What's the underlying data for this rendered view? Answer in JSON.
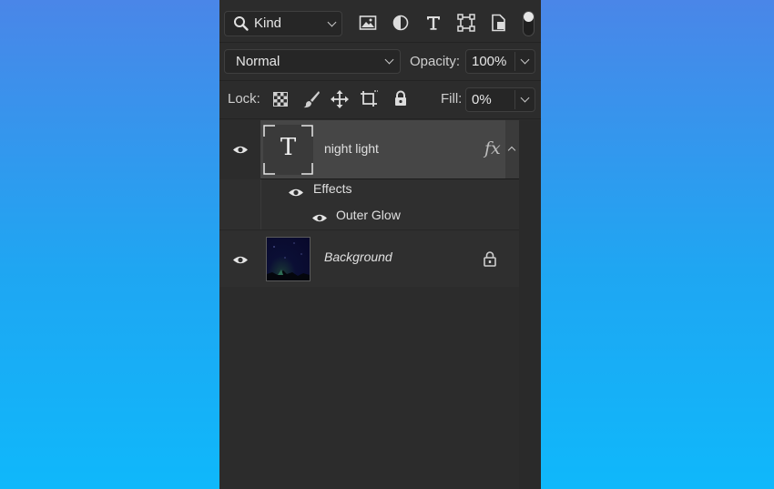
{
  "filter": {
    "kind_label": "Kind",
    "icons": [
      "search-icon",
      "image-filter-icon",
      "adjustment-filter-icon",
      "type-filter-icon",
      "shape-filter-icon",
      "smart-object-filter-icon",
      "filter-toggle"
    ]
  },
  "blend": {
    "mode": "Normal",
    "opacity_label": "Opacity:",
    "opacity_value": "100%"
  },
  "lock": {
    "label": "Lock:",
    "icons": [
      "lock-transparent-pixels-icon",
      "lock-image-pixels-icon",
      "lock-position-icon",
      "lock-artboard-icon",
      "lock-all-icon"
    ],
    "fill_label": "Fill:",
    "fill_value": "0%"
  },
  "layers": [
    {
      "name": "night light",
      "type": "text",
      "thumb_letter": "T",
      "fx": "fx",
      "selected": true,
      "effects": {
        "label": "Effects",
        "items": [
          "Outer Glow"
        ]
      }
    },
    {
      "name": "Background",
      "type": "image",
      "locked": true
    }
  ],
  "colors": {
    "panel_bg": "#2c2c2c",
    "selected_row": "#464646",
    "field_bg": "#262626"
  }
}
